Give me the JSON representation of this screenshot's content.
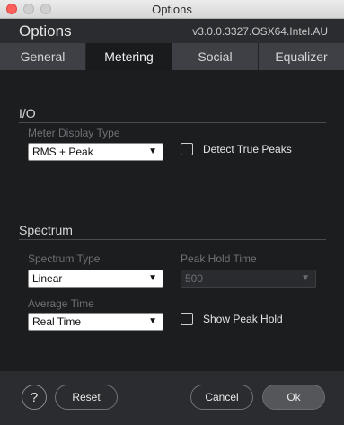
{
  "window": {
    "title": "Options"
  },
  "header": {
    "name": "Options",
    "version": "v3.0.0.3327.OSX64.Intel.AU"
  },
  "tabs": [
    {
      "label": "General",
      "active": false
    },
    {
      "label": "Metering",
      "active": true
    },
    {
      "label": "Social",
      "active": false
    },
    {
      "label": "Equalizer",
      "active": false
    }
  ],
  "io": {
    "title": "I/O",
    "meter_display_type_label": "Meter Display Type",
    "meter_display_type_value": "RMS + Peak",
    "detect_true_peaks_label": "Detect True Peaks",
    "detect_true_peaks_checked": false
  },
  "spectrum": {
    "title": "Spectrum",
    "spectrum_type_label": "Spectrum Type",
    "spectrum_type_value": "Linear",
    "peak_hold_time_label": "Peak Hold Time",
    "peak_hold_time_value": "500",
    "average_time_label": "Average Time",
    "average_time_value": "Real Time",
    "show_peak_hold_label": "Show Peak Hold",
    "show_peak_hold_checked": false
  },
  "footer": {
    "help_label": "?",
    "reset_label": "Reset",
    "cancel_label": "Cancel",
    "ok_label": "Ok"
  },
  "icons": {
    "dropdown_arrow": "▼"
  },
  "colors": {
    "background": "#1c1d1f",
    "tab_bar": "#3f4045",
    "active_tab": "#1a1b1d",
    "close_button": "#fc605b"
  }
}
